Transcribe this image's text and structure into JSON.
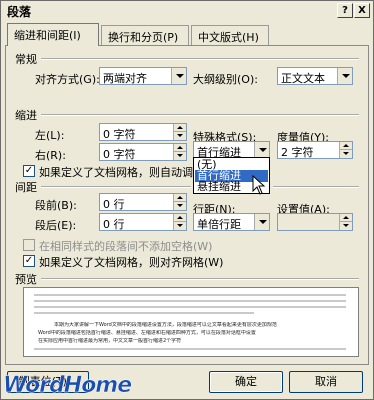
{
  "window": {
    "title": "段落",
    "help_label": "?",
    "close_label": "X"
  },
  "tabs": [
    {
      "label": "缩进和间距(I)",
      "active": true
    },
    {
      "label": "换行和分页(P)",
      "active": false
    },
    {
      "label": "中文版式(H)",
      "active": false
    }
  ],
  "general": {
    "section_label": "常规",
    "alignment_label": "对齐方式(G):",
    "alignment_value": "两端对齐",
    "outline_label": "大纲级别(O):",
    "outline_value": "正文文本"
  },
  "indent": {
    "section_label": "缩进",
    "left_label": "左(L):",
    "left_value": "0 字符",
    "right_label": "右(R):",
    "right_value": "0 字符",
    "special_label": "特殊格式(S):",
    "special_value": "首行缩进",
    "by_label": "度量值(Y):",
    "by_value": "2 字符",
    "auto_adjust_label": "如果定义了文档网格，则自动调",
    "auto_adjust_checked": true
  },
  "special_dropdown": {
    "options": [
      "(无)",
      "首行缩进",
      "悬挂缩进"
    ],
    "highlighted": "首行缩进"
  },
  "spacing": {
    "section_label": "间距",
    "before_label": "段前(B):",
    "before_value": "0 行",
    "after_label": "段后(E):",
    "after_value": "0 行",
    "line_label": "行距(N):",
    "line_value": "单倍行距",
    "at_label": "设置值(A):",
    "at_value": "",
    "no_space_label": "在相同样式的段落间不添加空格(W)",
    "no_space_checked": false,
    "snap_grid_label": "如果定义了文档网格，则对齐网格(W)",
    "snap_grid_checked": true
  },
  "preview": {
    "section_label": "预览",
    "sample_text": [
      "本期为大家讲解一下Word文档中的段落缩进设置方法，段落缩进可以让文章看起来更有层次更加规范",
      "Word中的段落缩进包括首行缩进、悬挂缩进、左缩进和右缩进四种方式，可以在段落对话框中设置",
      "在实际应用中首行缩进最为常用，中文文章一般首行缩进2个字符"
    ]
  },
  "buttons": {
    "tabs_label": "制表位(T)...",
    "ok_label": "确定",
    "cancel_label": "取消"
  },
  "watermark": "WordHome",
  "colors": {
    "dialog_bg": "#ece9d8",
    "selection": "#316ac5",
    "watermark": "#1a4fb0"
  }
}
